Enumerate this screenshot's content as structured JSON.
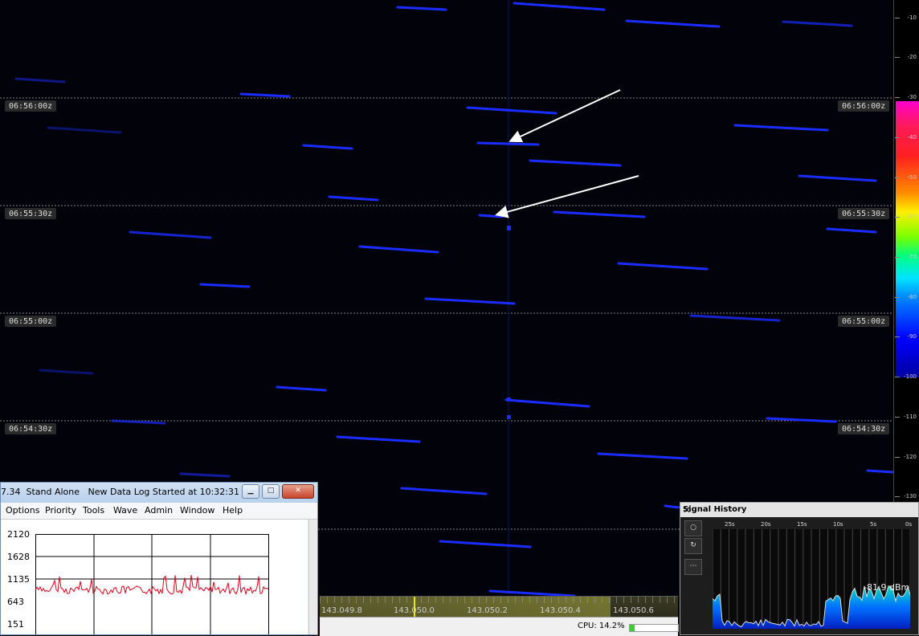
{
  "waterfall": {
    "time_labels": [
      "06:56:00z",
      "06:55:30z",
      "06:55:00z",
      "06:54:30z"
    ],
    "freq_labels": [
      "143.049.8",
      "143.050.0",
      "143.050.2",
      "143.050.4",
      "143.050.6"
    ],
    "cpu": "CPU: 14.2%"
  },
  "scale": {
    "ticks": [
      "-10",
      "-20",
      "-30",
      "-40",
      "-50",
      "-60",
      "-70",
      "-80",
      "-90",
      "-100",
      "-110",
      "-120",
      "-130"
    ]
  },
  "log_window": {
    "title": "7.34  Stand Alone   New Data Log Started at 10:32:31",
    "menu": [
      "Options",
      "Priority",
      "Tools",
      "Wave",
      "Admin",
      "Window",
      "Help"
    ],
    "y_labels": [
      "2120",
      "1628",
      "1135",
      "643",
      "151"
    ]
  },
  "signal_history": {
    "title": "Signal History",
    "close_glyph": "✕",
    "time_ticks": [
      "25s",
      "20s",
      "15s",
      "10s",
      "5s",
      "0s"
    ],
    "reading": "-81.9 dBm",
    "icons": [
      "record-icon",
      "refresh-icon",
      "more-icon"
    ]
  },
  "colors": {
    "trace": "#1a2cff",
    "log_line": "#e0001a",
    "accent_yellow": "#e8e800"
  }
}
